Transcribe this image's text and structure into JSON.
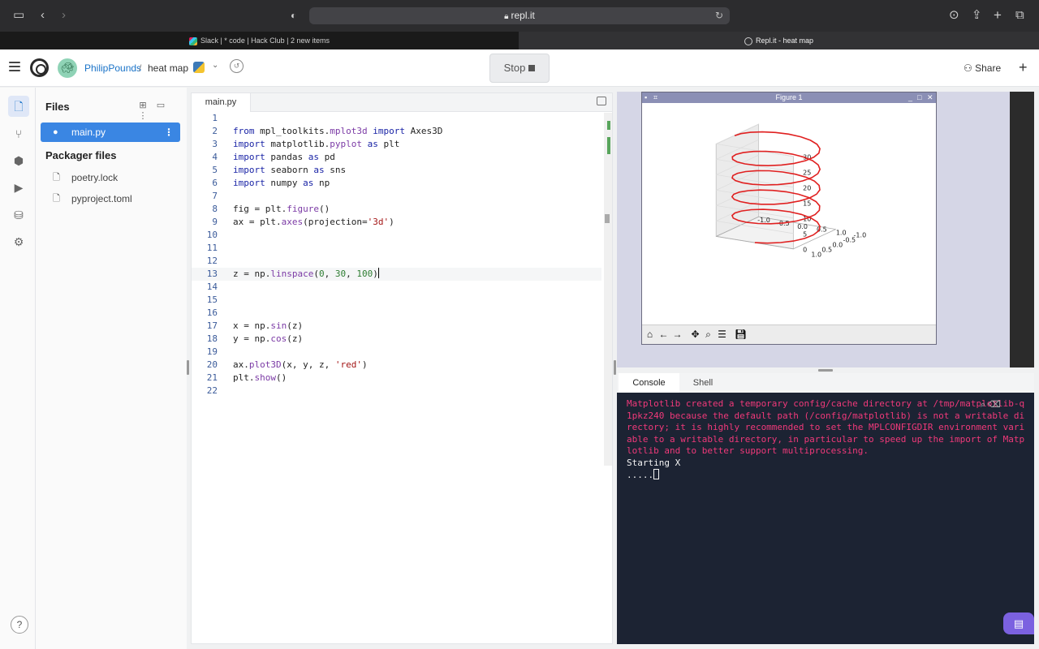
{
  "browser": {
    "url": "repl.it",
    "tabs": [
      {
        "title": "Slack | * code | Hack Club | 2 new items"
      },
      {
        "title": "Repl.it - heat map"
      }
    ]
  },
  "header": {
    "user": "PhilipPounds",
    "separator": "/",
    "repl_name": "heat map",
    "stop_label": "Stop",
    "share_label": "Share",
    "add_label": "+"
  },
  "files": {
    "title": "Files",
    "items": [
      {
        "name": "main.py"
      }
    ],
    "packager_title": "Packager files",
    "packager_items": [
      {
        "name": "poetry.lock"
      },
      {
        "name": "pyproject.toml"
      }
    ]
  },
  "editor": {
    "tab": "main.py",
    "lines": [
      {
        "n": "1",
        "html": ""
      },
      {
        "n": "2",
        "html": "<span class='kw'>from</span> mpl_toolkits.<span class='fn'>mplot3d</span> <span class='kw'>import</span> Axes3D"
      },
      {
        "n": "3",
        "html": "<span class='kw'>import</span> matplotlib.<span class='fn'>pyplot</span> <span class='kw'>as</span> plt"
      },
      {
        "n": "4",
        "html": "<span class='kw'>import</span> pandas <span class='kw'>as</span> pd"
      },
      {
        "n": "5",
        "html": "<span class='kw'>import</span> seaborn <span class='kw'>as</span> sns"
      },
      {
        "n": "6",
        "html": "<span class='kw'>import</span> numpy <span class='kw'>as</span> np"
      },
      {
        "n": "7",
        "html": ""
      },
      {
        "n": "8",
        "html": "fig = plt.<span class='fn'>figure</span>()"
      },
      {
        "n": "9",
        "html": "ax = plt.<span class='fn'>axes</span>(projection=<span class='str'>'3d'</span>)"
      },
      {
        "n": "10",
        "html": ""
      },
      {
        "n": "11",
        "html": ""
      },
      {
        "n": "12",
        "html": ""
      },
      {
        "n": "13",
        "html": "z = np.<span class='fn'>linspace</span>(<span class='num'>0</span>, <span class='num'>30</span>, <span class='num'>100</span>)<span class='cursor'></span>"
      },
      {
        "n": "14",
        "html": ""
      },
      {
        "n": "15",
        "html": ""
      },
      {
        "n": "16",
        "html": ""
      },
      {
        "n": "17",
        "html": "x = np.<span class='fn'>sin</span>(z)"
      },
      {
        "n": "18",
        "html": "y = np.<span class='fn'>cos</span>(z)"
      },
      {
        "n": "19",
        "html": ""
      },
      {
        "n": "20",
        "html": "ax.<span class='fn'>plot3D</span>(x, y, z, <span class='str'>'red'</span>)"
      },
      {
        "n": "21",
        "html": "plt.<span class='fn'>show</span>()"
      },
      {
        "n": "22",
        "html": ""
      }
    ]
  },
  "figure": {
    "window_title": "Figure 1",
    "color": "#e02020"
  },
  "chart_data": {
    "type": "line",
    "series": [
      {
        "color": "red",
        "function": "x = sin(z), y = cos(z), z = linspace(0, 30, 100)"
      }
    ],
    "x_ticks": [
      "-1.0",
      "-0.5",
      "0.0",
      "0.5",
      "1.0"
    ],
    "y_ticks": [
      "-1.0",
      "-0.5",
      "0.0",
      "0.5",
      "1.0"
    ],
    "z_ticks": [
      "0",
      "5",
      "10",
      "15",
      "20",
      "25",
      "30"
    ],
    "xlim": [
      -1,
      1
    ],
    "ylim": [
      -1,
      1
    ],
    "zlim": [
      0,
      30
    ]
  },
  "console": {
    "tabs": [
      {
        "label": "Console"
      },
      {
        "label": "Shell"
      }
    ],
    "warning": "Matplotlib created a temporary config/cache directory at /tmp/matplotlib-q1pkz240 because the default path (/config/matplotlib) is not a writable directory; it is highly recommended to set the MPLCONFIGDIR environment variable to a writable directory, in particular to speed up the import of Matplotlib and to better support multiprocessing.",
    "out1": "Starting X",
    "out2": "....."
  }
}
